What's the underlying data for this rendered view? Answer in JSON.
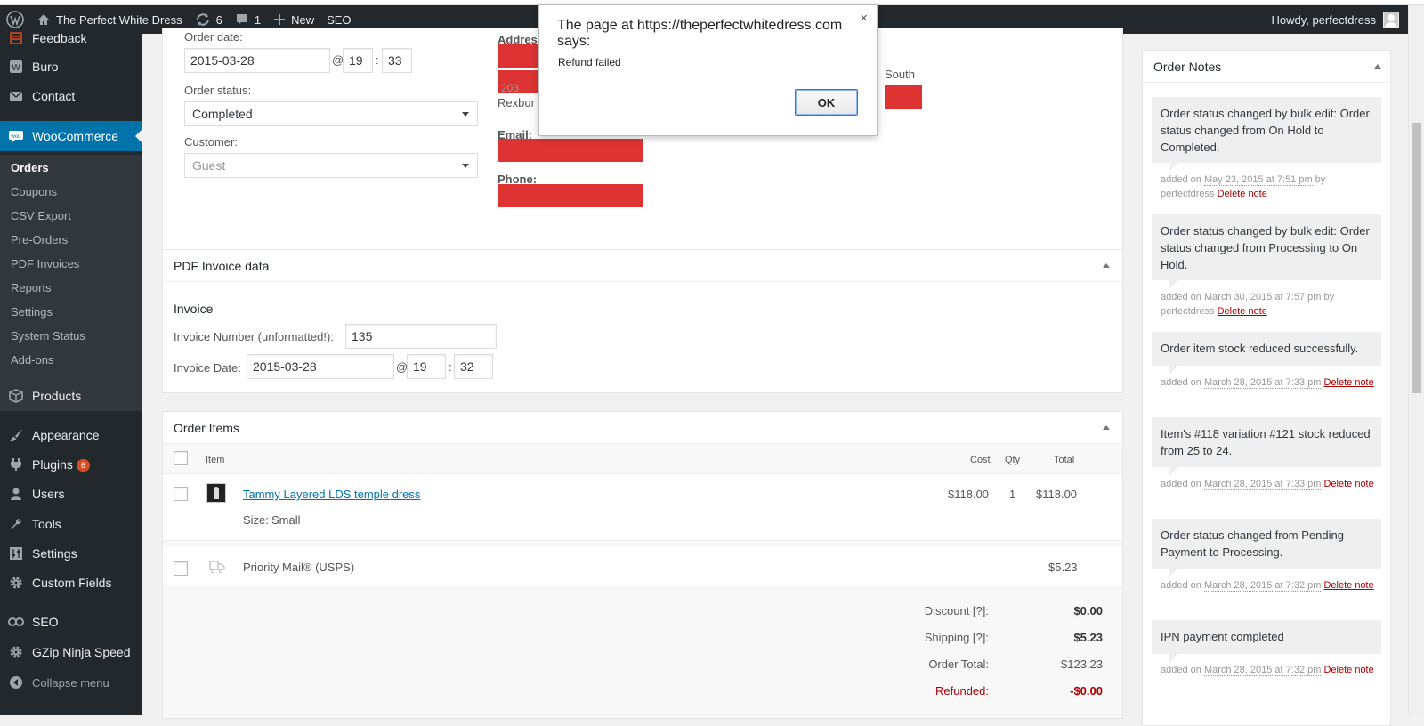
{
  "adminbar": {
    "site_name": "The Perfect White Dress",
    "updates_count": "6",
    "comments_count": "1",
    "new_label": "New",
    "seo_label": "SEO",
    "howdy": "Howdy, perfectdress"
  },
  "sidebar": {
    "feedback": "Feedback",
    "buro": "Buro",
    "contact": "Contact",
    "woocommerce": "WooCommerce",
    "sub": [
      "Orders",
      "Coupons",
      "CSV Export",
      "Pre-Orders",
      "PDF Invoices",
      "Reports",
      "Settings",
      "System Status",
      "Add-ons"
    ],
    "products": "Products",
    "appearance": "Appearance",
    "plugins": "Plugins",
    "plugins_badge": "6",
    "users": "Users",
    "tools": "Tools",
    "settings": "Settings",
    "custom_fields": "Custom Fields",
    "seo": "SEO",
    "gzip": "GZip Ninja Speed",
    "collapse": "Collapse menu"
  },
  "order": {
    "date_label": "Order date:",
    "date": "2015-03-28",
    "at": "@",
    "hour": "19",
    "colon": ":",
    "minute": "33",
    "status_label": "Order status:",
    "status": "Completed",
    "customer_label": "Customer:",
    "customer": "Guest",
    "address_label": "Addres",
    "address_fragment_1": "203",
    "address_fragment_2": "Rexbur",
    "south": "South",
    "email_label": "Email:",
    "phone_label": "Phone:"
  },
  "pdf": {
    "title": "PDF Invoice data",
    "section": "Invoice",
    "number_label": "Invoice Number (unformatted!):",
    "number": "135",
    "date_label": "Invoice Date:",
    "date": "2015-03-28",
    "at": "@",
    "hour": "19",
    "colon": ":",
    "minute": "32"
  },
  "items": {
    "title": "Order Items",
    "col_item": "Item",
    "col_cost": "Cost",
    "col_qty": "Qty",
    "col_total": "Total",
    "product_name": "Tammy Layered LDS temple dress",
    "size_label": "Size:",
    "size": "Small",
    "cost": "$118.00",
    "qty": "1",
    "total": "$118.00",
    "shipping_name": "Priority Mail® (USPS)",
    "shipping_total": "$5.23",
    "discount_label": "Discount [?]:",
    "discount": "$0.00",
    "shipping_label": "Shipping [?]:",
    "shipping": "$5.23",
    "order_total_label": "Order Total:",
    "order_total": "$123.23",
    "refunded_label": "Refunded:",
    "refunded": "-$0.00"
  },
  "notes": {
    "title": "Order Notes",
    "list": [
      {
        "text": "Order status changed by bulk edit: Order status changed from On Hold to Completed.",
        "added": "added on ",
        "date": "May 23, 2015 at 7:51 pm",
        "by": " by perfectdress ",
        "delete": "Delete note"
      },
      {
        "text": "Order status changed by bulk edit: Order status changed from Processing to On Hold.",
        "added": "added on ",
        "date": "March 30, 2015 at 7:57 pm",
        "by": " by perfectdress ",
        "delete": "Delete note"
      },
      {
        "text": "Order item stock reduced successfully.",
        "added": "added on ",
        "date": "March 28, 2015 at 7:33 pm",
        "by": " ",
        "delete": "Delete note"
      },
      {
        "text": "Item's #118 variation #121 stock reduced from 25 to 24.",
        "added": "added on ",
        "date": "March 28, 2015 at 7:33 pm",
        "by": " ",
        "delete": "Delete note"
      },
      {
        "text": "Order status changed from Pending Payment to Processing.",
        "added": "added on ",
        "date": "March 28, 2015 at 7:32 pm",
        "by": " ",
        "delete": "Delete note"
      },
      {
        "text": "IPN payment completed",
        "added": "added on ",
        "date": "March 28, 2015 at 7:32 pm",
        "by": " ",
        "delete": "Delete note"
      }
    ]
  },
  "dialog": {
    "title": "The page at https://theperfectwhitedress.com says:",
    "message": "Refund failed",
    "ok": "OK",
    "close": "×"
  },
  "colors": {
    "accent": "#0073aa",
    "redaction": "#dd3333",
    "adminbar": "#23282d"
  }
}
